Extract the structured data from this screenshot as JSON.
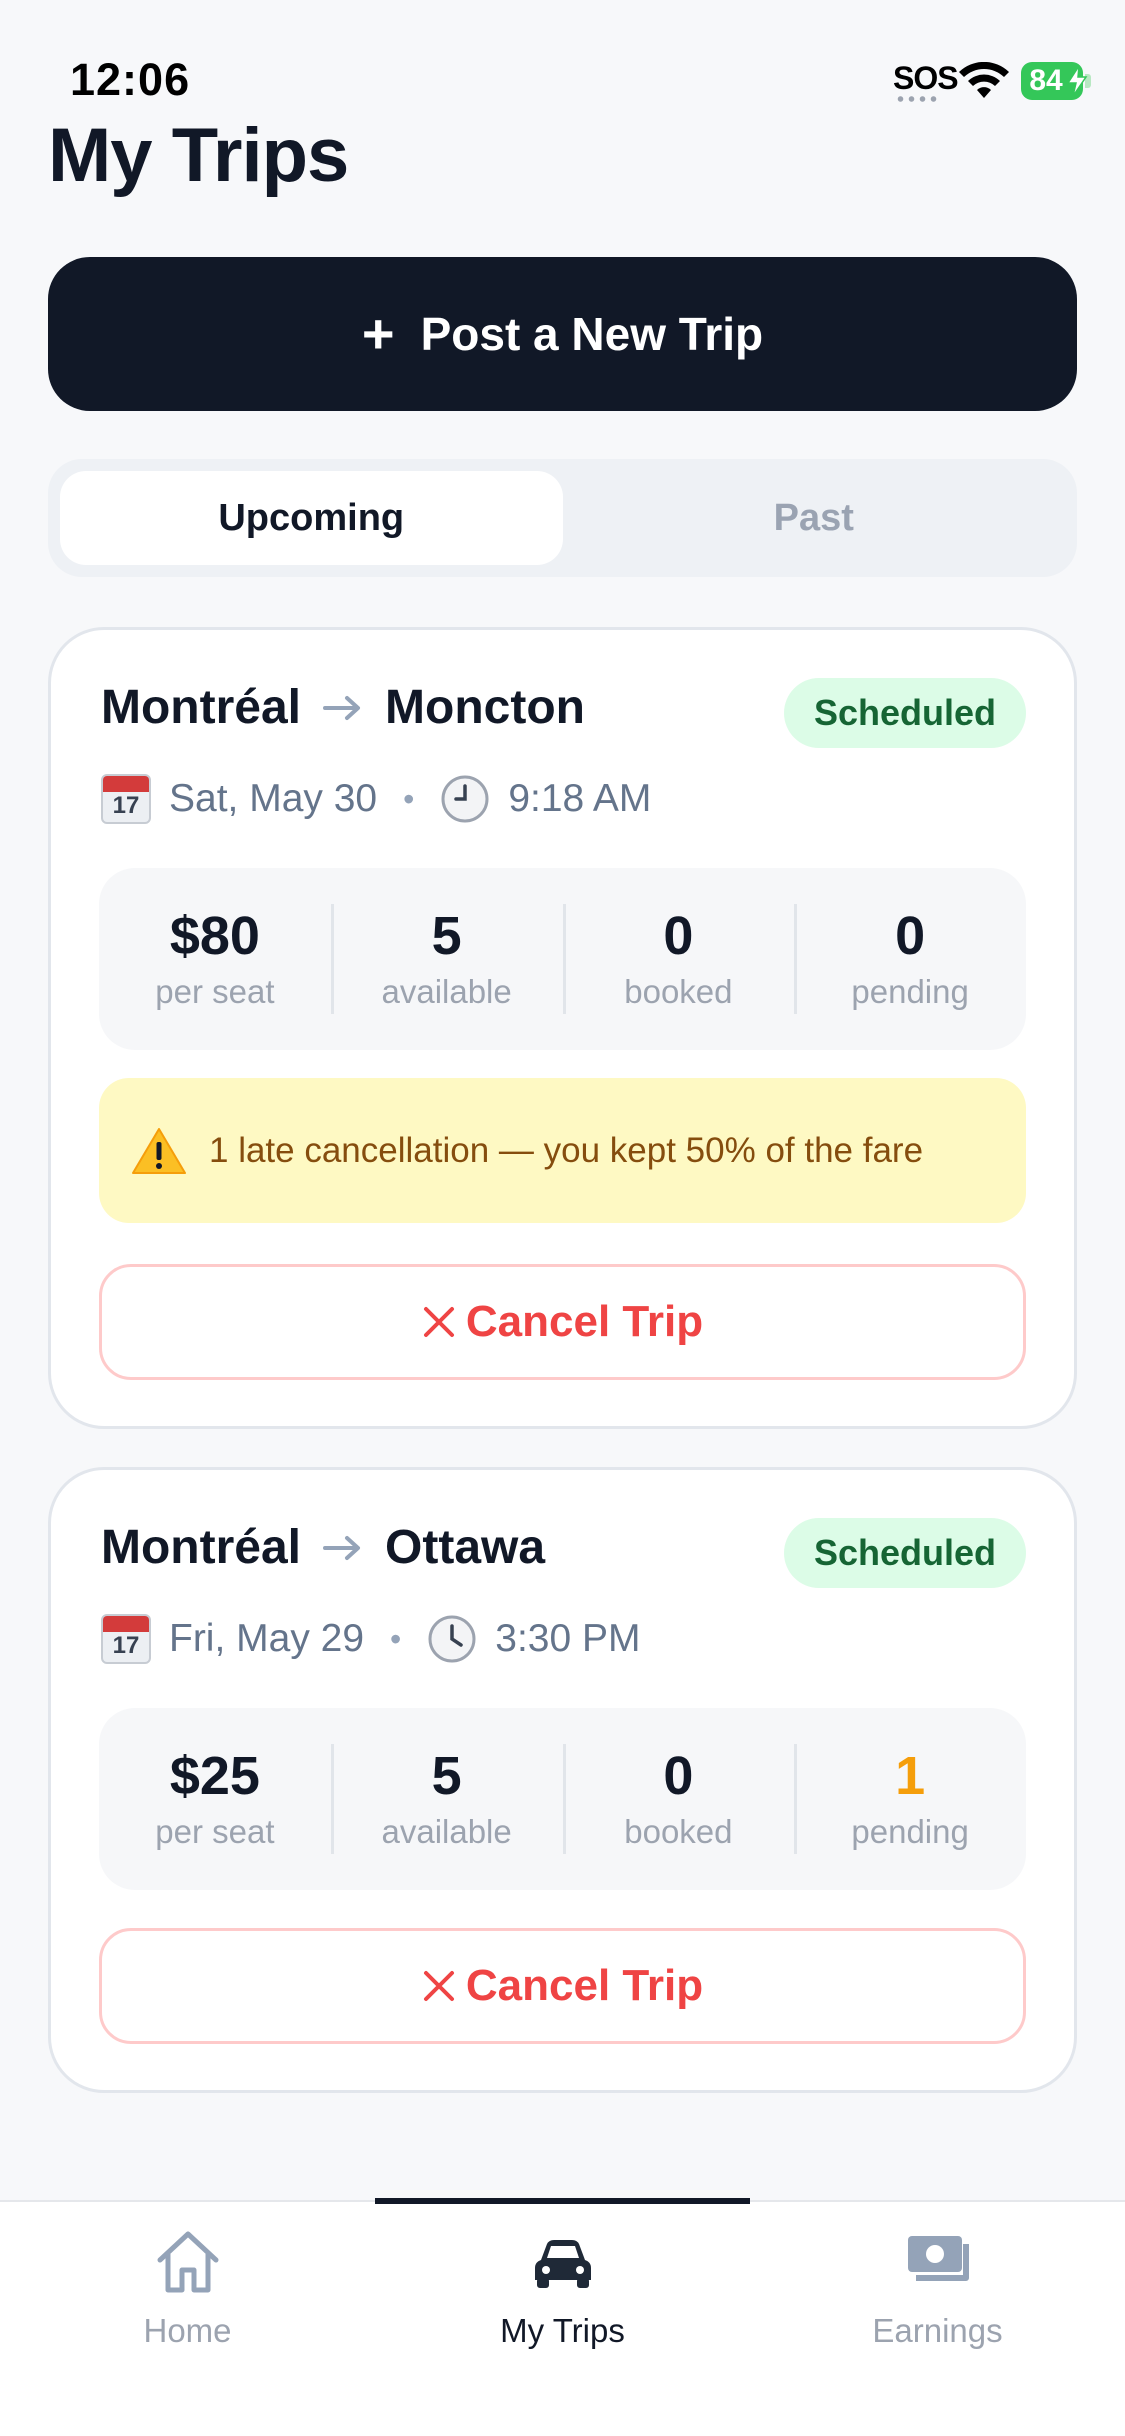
{
  "status_bar": {
    "time": "12:06",
    "sos": "SOS",
    "battery": "84"
  },
  "page_title": "My Trips",
  "post_button": {
    "icon": "plus-icon",
    "label": "Post a New Trip"
  },
  "segments": {
    "upcoming": "Upcoming",
    "past": "Past",
    "selected": "Upcoming"
  },
  "trips": [
    {
      "from": "Montréal",
      "to": "Moncton",
      "status": "Scheduled",
      "calendar_icon_day": "17",
      "date": "Sat, May 30",
      "time": "9:18 AM",
      "stats": [
        {
          "value": "$80",
          "label": "per seat"
        },
        {
          "value": "5",
          "label": "available"
        },
        {
          "value": "0",
          "label": "booked"
        },
        {
          "value": "0",
          "label": "pending"
        }
      ],
      "warning": "1 late cancellation — you kept 50% of the fare",
      "cancel_label": "Cancel Trip"
    },
    {
      "from": "Montréal",
      "to": "Ottawa",
      "status": "Scheduled",
      "calendar_icon_day": "17",
      "date": "Fri, May 29",
      "time": "3:30 PM",
      "stats": [
        {
          "value": "$25",
          "label": "per seat"
        },
        {
          "value": "5",
          "label": "available"
        },
        {
          "value": "0",
          "label": "booked"
        },
        {
          "value": "1",
          "label": "pending"
        }
      ],
      "cancel_label": "Cancel Trip"
    }
  ],
  "tab_bar": {
    "items": [
      {
        "label": "Home",
        "icon": "home-icon"
      },
      {
        "label": "My Trips",
        "icon": "car-icon"
      },
      {
        "label": "Earnings",
        "icon": "cash-icon"
      }
    ],
    "active": "My Trips"
  },
  "colors": {
    "primary": "#111827",
    "success_bg": "#dcfce7",
    "success_text": "#166534",
    "danger": "#ef4444",
    "warning_bg": "#fef9c3",
    "pending_accent": "#f59e0b"
  }
}
